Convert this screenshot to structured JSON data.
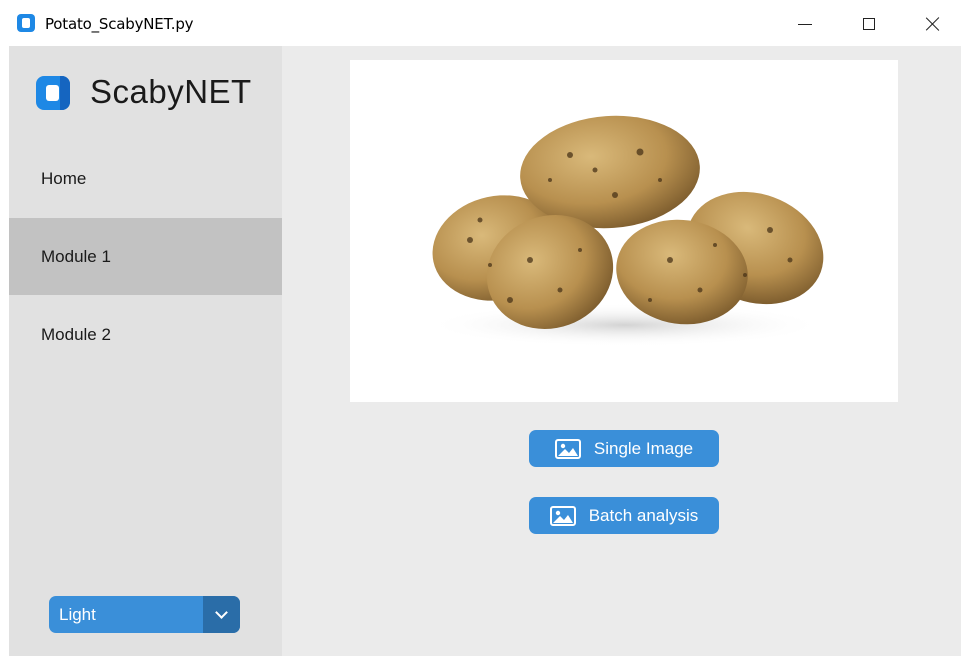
{
  "window": {
    "title": "Potato_ScabyNET.py",
    "controls": [
      "minimize-icon",
      "maximize-icon",
      "close-icon"
    ]
  },
  "sidebar": {
    "brand": "ScabyNET",
    "items": [
      {
        "label": "Home",
        "selected": false
      },
      {
        "label": "Module 1",
        "selected": true
      },
      {
        "label": "Module 2",
        "selected": false
      }
    ],
    "appearance": {
      "value": "Light"
    }
  },
  "main": {
    "image_alt": "potato-photo",
    "buttons": {
      "single": "Single Image",
      "batch": "Batch analysis"
    }
  },
  "colors": {
    "accent": "#3a8fd9",
    "accent_dark": "#2a6da8",
    "sidebar_bg": "#e1e1e1",
    "selected_bg": "#c2c2c2",
    "main_bg": "#ebebeb"
  }
}
